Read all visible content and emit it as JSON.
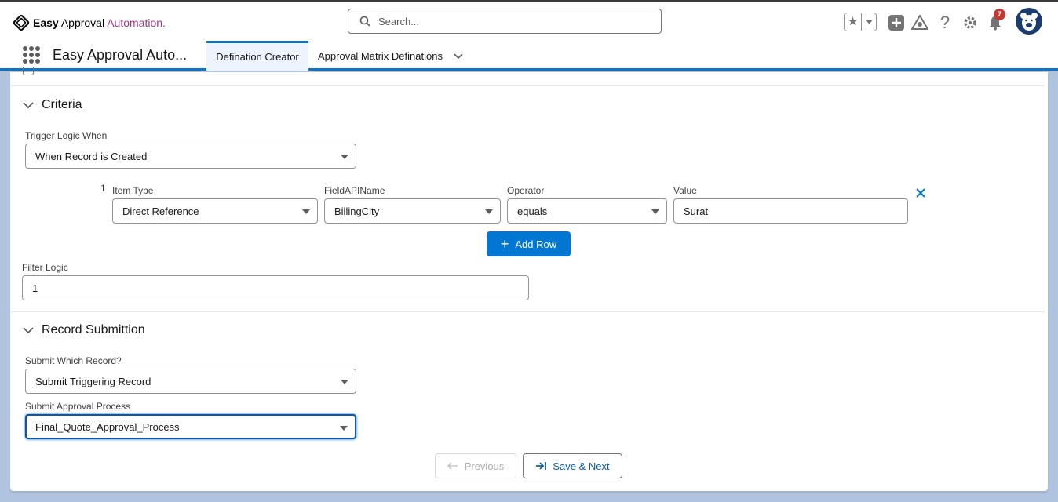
{
  "header": {
    "logo": {
      "easy": "Easy",
      "approval": " Approval",
      "automation": " Automation."
    },
    "search_placeholder": "Search...",
    "notifications_count": "7",
    "brand_color": "#0176d3"
  },
  "nav": {
    "app_name": "Easy Approval Auto...",
    "tabs": [
      {
        "label": "Defination Creator",
        "active": true
      },
      {
        "label": "Approval Matrix Definations",
        "active": false
      }
    ]
  },
  "criteria": {
    "title": "Criteria",
    "trigger_label": "Trigger Logic When",
    "trigger_value": "When Record is Created",
    "row": {
      "number": "1",
      "item_type_label": "Item Type",
      "item_type_value": "Direct Reference",
      "field_label": "FieldAPIName",
      "field_value": "BillingCity",
      "operator_label": "Operator",
      "operator_value": "equals",
      "value_label": "Value",
      "value_value": "Surat"
    },
    "add_row_label": "Add Row",
    "filter_logic_label": "Filter Logic",
    "filter_logic_value": "1"
  },
  "submission": {
    "title": "Record Submittion",
    "which_label": "Submit Which Record?",
    "which_value": "Submit Triggering Record",
    "process_label": "Submit Approval Process",
    "process_value": "Final_Quote_Approval_Process"
  },
  "footer": {
    "previous_label": "Previous",
    "save_next_label": "Save & Next"
  }
}
